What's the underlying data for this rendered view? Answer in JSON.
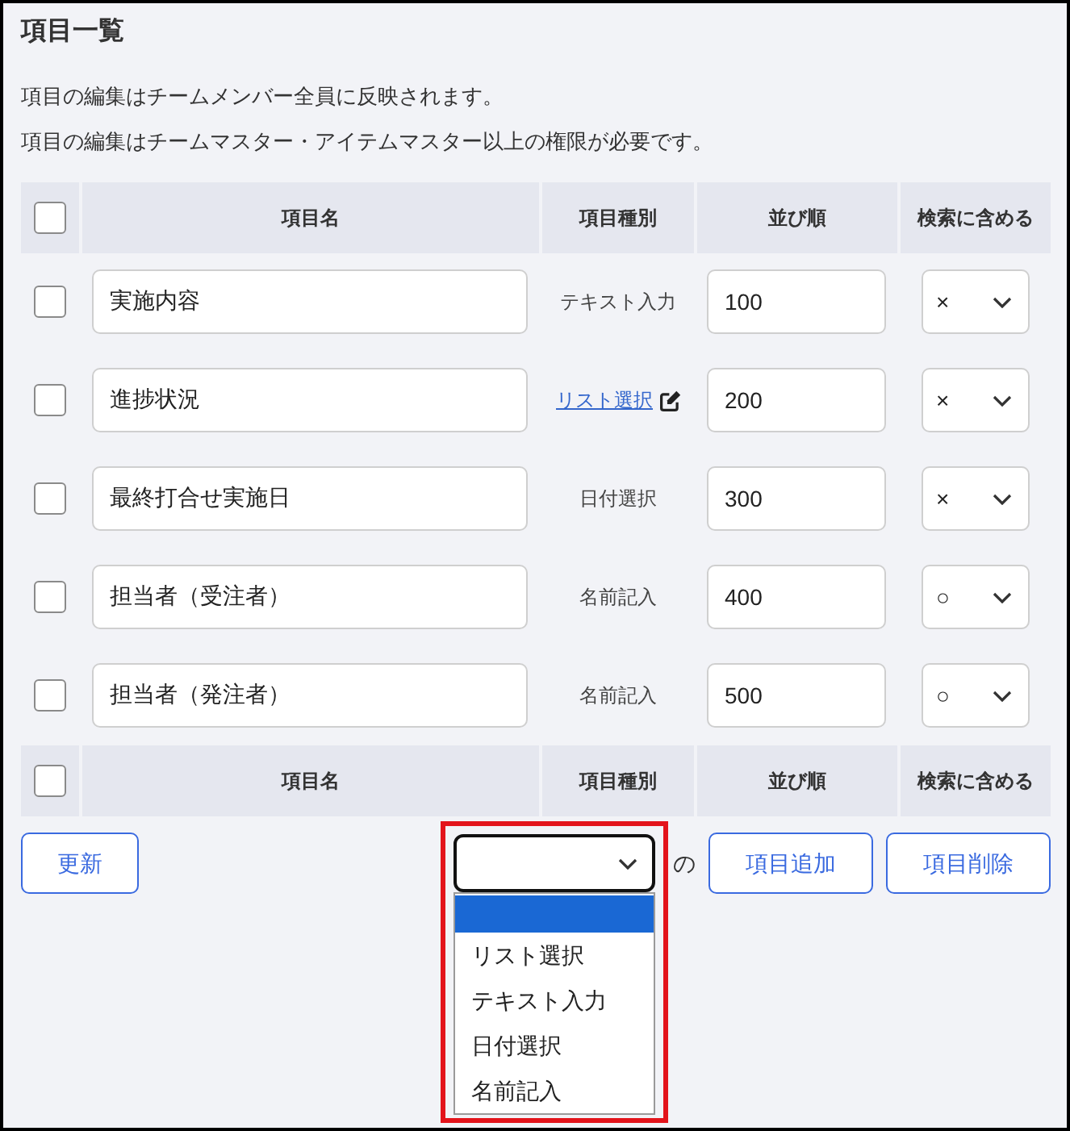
{
  "title": "項目一覧",
  "notes": [
    "項目の編集はチームメンバー全員に反映されます。",
    "項目の編集はチームマスター・アイテムマスター以上の権限が必要です。"
  ],
  "table": {
    "header": {
      "checked": false,
      "columns": [
        "項目名",
        "項目種別",
        "並び順",
        "検索に含める"
      ]
    },
    "rows": [
      {
        "checked": false,
        "name": "実施内容",
        "type": {
          "kind": "plain",
          "label": "テキスト入力"
        },
        "order": "100",
        "search": "×"
      },
      {
        "checked": false,
        "name": "進捗状況",
        "type": {
          "kind": "link",
          "label": "リスト選択"
        },
        "order": "200",
        "search": "×"
      },
      {
        "checked": false,
        "name": "最終打合せ実施日",
        "type": {
          "kind": "plain",
          "label": "日付選択"
        },
        "order": "300",
        "search": "×"
      },
      {
        "checked": false,
        "name": "担当者（受注者）",
        "type": {
          "kind": "plain",
          "label": "名前記入"
        },
        "order": "400",
        "search": "○"
      },
      {
        "checked": false,
        "name": "担当者（発注者）",
        "type": {
          "kind": "plain",
          "label": "名前記入"
        },
        "order": "500",
        "search": "○"
      }
    ],
    "footer": {
      "checked": false,
      "columns": [
        "項目名",
        "項目種別",
        "並び順",
        "検索に含める"
      ]
    }
  },
  "actions": {
    "update_button": "更新",
    "type_select": {
      "focused": true,
      "highlighted": true,
      "open": true,
      "options": [
        {
          "selected": true
        },
        {
          "label": "リスト選択",
          "selected": false
        },
        {
          "label": "テキスト入力",
          "selected": false
        },
        {
          "label": "日付選択",
          "selected": false
        },
        {
          "label": "名前記入",
          "selected": false
        }
      ]
    },
    "connector": "の",
    "buttons": [
      "項目追加",
      "項目削除"
    ]
  }
}
